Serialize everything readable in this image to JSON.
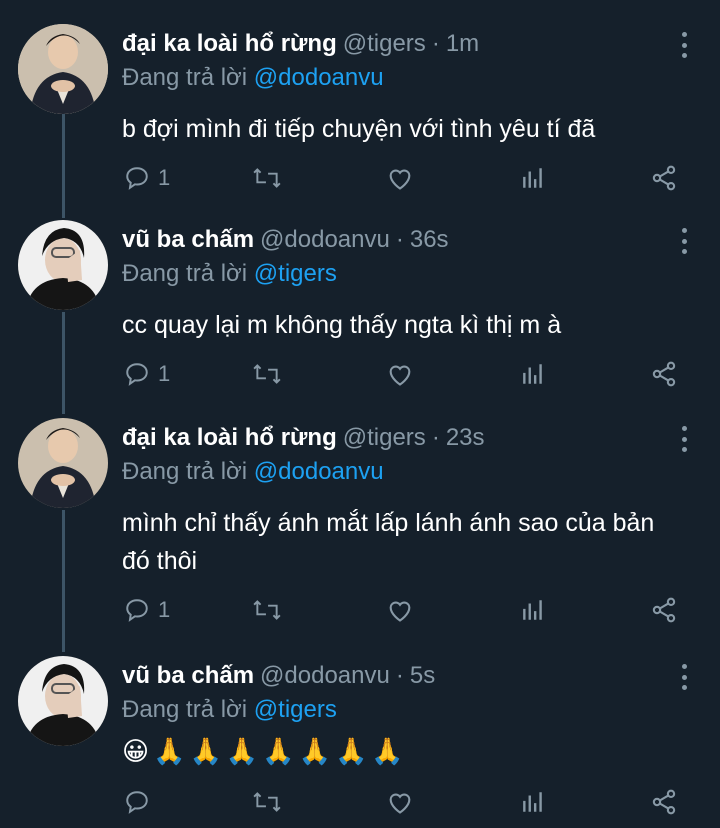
{
  "tweets": [
    {
      "name": "đại ka loài hổ rừng",
      "handle": "@tigers",
      "time": "1m",
      "reply_prefix": "Đang trả lời",
      "reply_to": "@dodoanvu",
      "text": "b đợi mình đi tiếp chuyện với tình yêu tí đã",
      "reply_count": "1",
      "avatar": "tiger-user-avatar"
    },
    {
      "name": "vũ ba chấm",
      "handle": "@dodoanvu",
      "time": "36s",
      "reply_prefix": "Đang trả lời",
      "reply_to": "@tigers",
      "text": "cc quay lại m không thấy ngta kì thị m à",
      "reply_count": "1",
      "avatar": "dodoanvu-user-avatar"
    },
    {
      "name": "đại ka loài hổ rừng",
      "handle": "@tigers",
      "time": "23s",
      "reply_prefix": "Đang trả lời",
      "reply_to": "@dodoanvu",
      "text_line1": "mình chỉ thấy ánh mắt lấp lánh ánh sao của bản",
      "text_line2": "đó thôi",
      "reply_count": "1",
      "avatar": "tiger-user-avatar"
    },
    {
      "name": "vũ ba chấm",
      "handle": "@dodoanvu",
      "time": "5s",
      "reply_prefix": "Đang trả lời",
      "reply_to": "@tigers",
      "emojis": [
        "😀",
        "🙏",
        "🙏",
        "🙏",
        "🙏",
        "🙏",
        "🙏",
        "🙏"
      ],
      "reply_count": "",
      "avatar": "dodoanvu-user-avatar"
    }
  ],
  "dot_separator": "·",
  "colors": {
    "background": "#15202b",
    "secondary_text": "#8899a6",
    "mention": "#1da1f2",
    "thread_line": "#3d5466"
  },
  "icons": [
    "reply-icon",
    "retweet-icon",
    "like-icon",
    "analytics-icon",
    "share-icon",
    "more-options-icon"
  ]
}
